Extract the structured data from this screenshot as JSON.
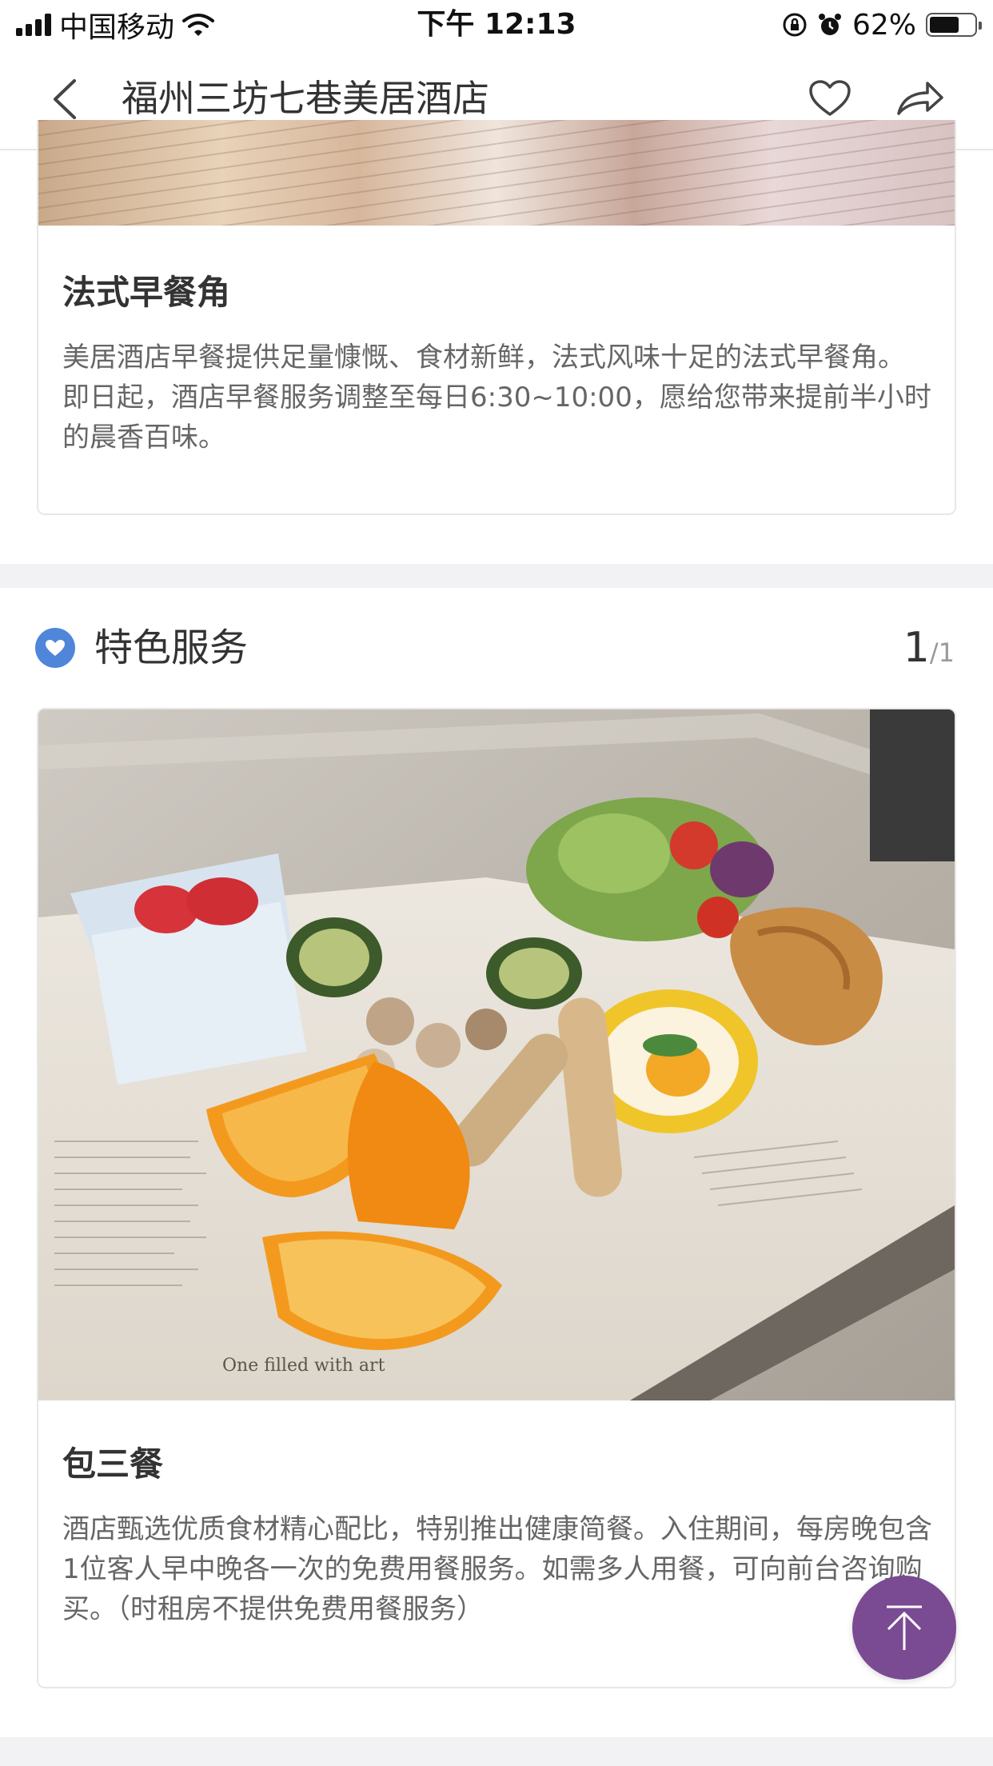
{
  "status_bar": {
    "carrier": "中国移动",
    "time": "下午 12:13",
    "battery": "62%"
  },
  "nav": {
    "title": "福州三坊七巷美居酒店"
  },
  "breakfast_card": {
    "title": "法式早餐角",
    "description": "美居酒店早餐提供足量慷慨、食材新鲜，法式风味十足的法式早餐角。 即日起，酒店早餐服务调整至每日6:30~10:00，愿给您带来提前半小时的晨香百味。"
  },
  "special_services": {
    "title": "特色服务",
    "page_current": "1",
    "page_total": "/1"
  },
  "service_card": {
    "title": "包三餐",
    "description": "酒店甄选优质食材精心配比，特别推出健康简餐。入住期间，每房晚包含1位客人早中晚各一次的免费用餐服务。如需多人用餐，可向前台咨询购买。（时租房不提供免费用餐服务）",
    "image_caption": "One filled with art"
  },
  "colors": {
    "section_icon": "#4f86d9",
    "scroll_top_button": "#7a4a92",
    "divider": "#f2f2f4"
  },
  "icons": {
    "back": "chevron-left-icon",
    "favorite": "heart-outline-icon",
    "share": "share-arrow-icon",
    "section": "heart-badge-icon",
    "scroll_top": "arrow-up-icon"
  }
}
